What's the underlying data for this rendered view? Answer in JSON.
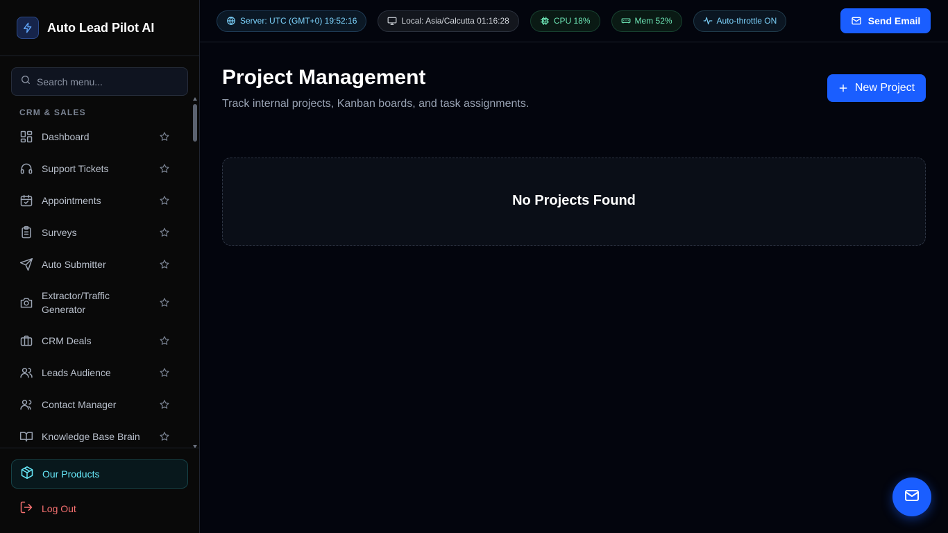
{
  "brand": {
    "name": "Auto Lead Pilot AI",
    "icon": "lightning-icon",
    "accent": "#3b82f6"
  },
  "search": {
    "placeholder": "Search menu..."
  },
  "sidebar": {
    "section_label": "CRM & SALES",
    "items": [
      {
        "label": "Dashboard",
        "icon": "dashboard-grid-icon"
      },
      {
        "label": "Support Tickets",
        "icon": "headset-icon"
      },
      {
        "label": "Appointments",
        "icon": "calendar-check-icon"
      },
      {
        "label": "Surveys",
        "icon": "clipboard-list-icon"
      },
      {
        "label": "Auto Submitter",
        "icon": "send-icon"
      },
      {
        "label": "Extractor/Traffic Generator",
        "icon": "camera-icon"
      },
      {
        "label": "CRM Deals",
        "icon": "briefcase-icon"
      },
      {
        "label": "Leads Audience",
        "icon": "users-icon"
      },
      {
        "label": "Contact Manager",
        "icon": "contacts-icon"
      },
      {
        "label": "Knowledge Base Brain",
        "icon": "book-open-icon"
      }
    ],
    "products_label": "Our Products",
    "logout_label": "Log Out"
  },
  "topbar": {
    "server_time": "Server: UTC (GMT+0) 19:52:16",
    "local_time": "Local: Asia/Calcutta 01:16:28",
    "cpu": "CPU 18%",
    "mem": "Mem 52%",
    "throttle": "Auto-throttle ON",
    "send_email_label": "Send Email"
  },
  "page": {
    "title": "Project Management",
    "subtitle": "Track internal projects, Kanban boards, and task assignments.",
    "new_project_label": "New Project",
    "empty_state": "No Projects Found"
  },
  "colors": {
    "primary": "#1a5eff",
    "background": "#03050d",
    "sidebar": "#090909",
    "cyan": "#67e8f9",
    "danger": "#f87171",
    "green": "#6ee7b7"
  }
}
